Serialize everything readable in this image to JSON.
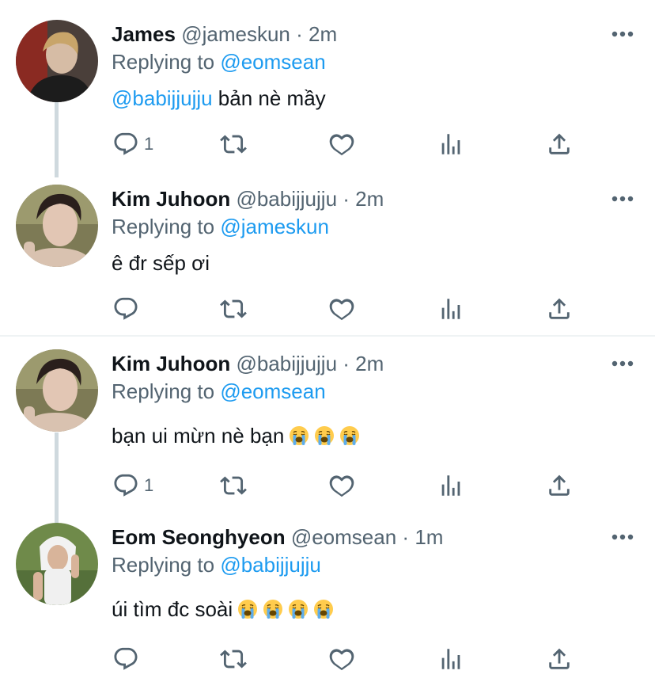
{
  "tweets": [
    {
      "name": "James",
      "handle": "@jameskun",
      "time": "2m",
      "replying_prefix": "Replying to",
      "replying_to": "@eomsean",
      "mention": "@babijjujju",
      "text": " bản nè mầy",
      "emoji_count": 0,
      "reply_count": "1"
    },
    {
      "name": "Kim Juhoon",
      "handle": "@babijjujju",
      "time": "2m",
      "replying_prefix": "Replying to",
      "replying_to": "@jameskun",
      "mention": "",
      "text": "ê đr sếp ơi",
      "emoji_count": 0,
      "reply_count": ""
    },
    {
      "name": "Kim Juhoon",
      "handle": "@babijjujju",
      "time": "2m",
      "replying_prefix": "Replying to",
      "replying_to": "@eomsean",
      "mention": "",
      "text": "bạn ui mừn nè bạn",
      "emoji": "😭",
      "emoji_count": 3,
      "reply_count": "1"
    },
    {
      "name": "Eom Seonghyeon",
      "handle": "@eomsean",
      "time": "1m",
      "replying_prefix": "Replying to",
      "replying_to": "@babijjujju",
      "mention": "",
      "text": "úi tìm đc soài",
      "emoji": "😭",
      "emoji_count": 4,
      "reply_count": ""
    }
  ],
  "separator": "·",
  "icons": {
    "more": "more-icon",
    "reply": "reply-icon",
    "retweet": "retweet-icon",
    "like": "like-icon",
    "stats": "stats-icon",
    "share": "share-icon"
  },
  "colors": {
    "mention": "#1d9bf0",
    "secondary": "#536471",
    "thread_line": "#cfd9de"
  }
}
